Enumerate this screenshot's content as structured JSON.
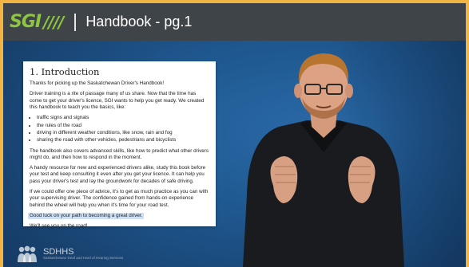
{
  "header": {
    "logo_text": "SGI",
    "logo_mark": "////",
    "title": "Handbook - pg.1"
  },
  "document": {
    "heading": "1.   Introduction",
    "intro": "Thanks for picking up the Saskatchewan Driver's Handbook!",
    "para1": "Driver training is a rite of passage many of us share. Now that the time has come to get your driver's licence, SGI wants to help you get ready. We created this handbook to teach you the basics, like:",
    "bullets": [
      "traffic signs and signals",
      "the rules of the road",
      "driving in different weather conditions, like snow, rain and fog",
      "sharing the road with other vehicles, pedestrians and bicyclists"
    ],
    "para2": "The handbook also covers advanced skills, like how to predict what other drivers might do, and then how to respond in the moment.",
    "para3": "A handy resource for new and experienced drivers alike, study this book before your test and keep consulting it even after you get your licence. It can help you pass your driver's test and lay the groundwork for decades of safe driving.",
    "para4": "If we could offer one piece of advice, it's to get as much practice as you can with your supervising driver. The confidence gained from hands-on experience behind the wheel will help you when it's time for your road test.",
    "highlight": "Good luck on your path to becoming a great driver.",
    "closing": "We'll see you on the road!"
  },
  "footer": {
    "org_name": "SDHHS",
    "org_sub": "Saskatchewan Deaf and Hard of Hearing Services"
  },
  "colors": {
    "accent_green": "#8dc63f",
    "titlebar": "#3f4448",
    "border_yellow": "#f2b544",
    "stage_blue": "#1f5890",
    "highlight": "#cde0f6"
  }
}
